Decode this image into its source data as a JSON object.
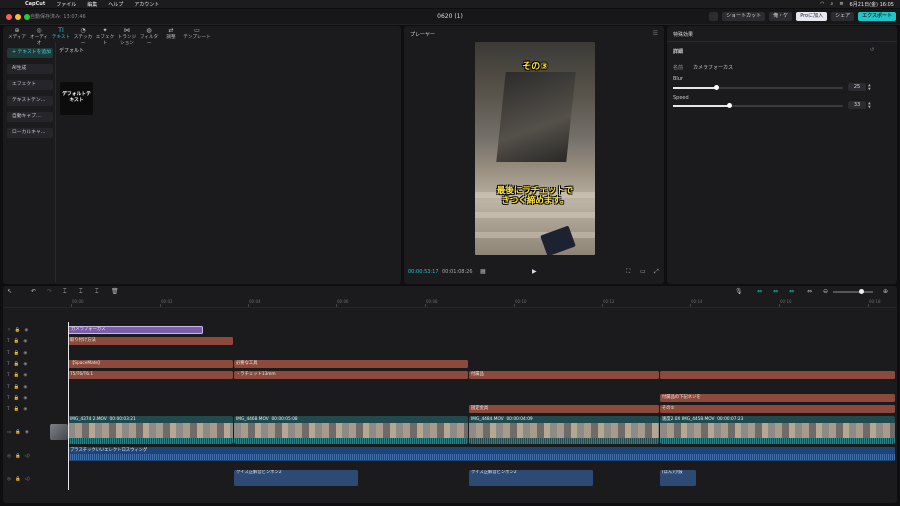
{
  "menubar": {
    "app": "CapCut",
    "items": [
      "ファイル",
      "編集",
      "ヘルプ",
      "アカウント"
    ],
    "datetime": "6月21日(金) 16:05"
  },
  "titlebar": {
    "autosave": "自動保存済み: 13:07:46",
    "title": "0620 (1)",
    "shortcut_label": "ショートカット",
    "user_label": "俺・ケ",
    "pro_label": "Proに加入",
    "share_label": "シェア",
    "export_label": "エクスポート"
  },
  "left_panel": {
    "tools": [
      {
        "label": "メディア",
        "icon": "media-icon"
      },
      {
        "label": "オーディオ",
        "icon": "audio-icon"
      },
      {
        "label": "テキスト",
        "icon": "text-icon"
      },
      {
        "label": "ステッカー",
        "icon": "sticker-icon"
      },
      {
        "label": "エフェクト",
        "icon": "effect-icon"
      },
      {
        "label": "トランジション",
        "icon": "transition-icon"
      },
      {
        "label": "フィルター",
        "icon": "filter-icon"
      },
      {
        "label": "調整",
        "icon": "adjust-icon"
      },
      {
        "label": "テンプレート",
        "icon": "template-icon"
      }
    ],
    "side_items": [
      "+ テキストを追加",
      "AI生成",
      "エフェクト",
      "テキストテン…",
      "自動キャプ…",
      "ローカルキャ…"
    ],
    "section_title": "デフォルト",
    "card_label": "デフォルトテキスト"
  },
  "player": {
    "title": "プレーヤー",
    "caption_top": "その③",
    "caption_bottom_1": "最後にラチェットで",
    "caption_bottom_2": "きつく締めます。",
    "current_time": "00:00:53:17",
    "duration": "00:01:08:26"
  },
  "right_panel": {
    "title": "特殊効果",
    "section": "詳細",
    "name_label": "名前",
    "name_value": "カメラフォーカス",
    "blur_label": "Blur",
    "blur_value": 25,
    "blur_display": "25",
    "speed_label": "Speed",
    "speed_value": 33,
    "speed_display": "33"
  },
  "timeline": {
    "ticks": [
      "00:00",
      "00:02",
      "00:04",
      "00:06",
      "00:08",
      "00:10",
      "00:12",
      "00:14",
      "00:16",
      "00:18"
    ],
    "effect_clip": "カメラフォーカス",
    "text_clips": {
      "t1": "取り付け方法",
      "t2": "【SpaceMate】",
      "t3": "必要な工具",
      "t4": "T5/T6/T6.1",
      "t5": "・ラチェット13mm",
      "t6": "付属品",
      "t7": "固定金具",
      "t8": "付属品の下記ネジを",
      "t9": "その①"
    },
    "video_clips": [
      {
        "name": "IMG_4374 2.MOV",
        "time": "00:00:03:21"
      },
      {
        "name": "IMG_4468.MOV",
        "time": "00:00:05:08"
      },
      {
        "name": "IMG_4484.MOV",
        "time": "00:00:04:09"
      },
      {
        "name": "速度2.0X IMG_4458.MOV",
        "time": "00:00:07:23"
      }
    ],
    "music_clip": "プラスチックいいエレクトロスウィング",
    "audio_clips": [
      "クイズ正解音ピンポン2",
      "クイズ正解音ピンポン2",
      "(ぽん)小鼓"
    ]
  }
}
